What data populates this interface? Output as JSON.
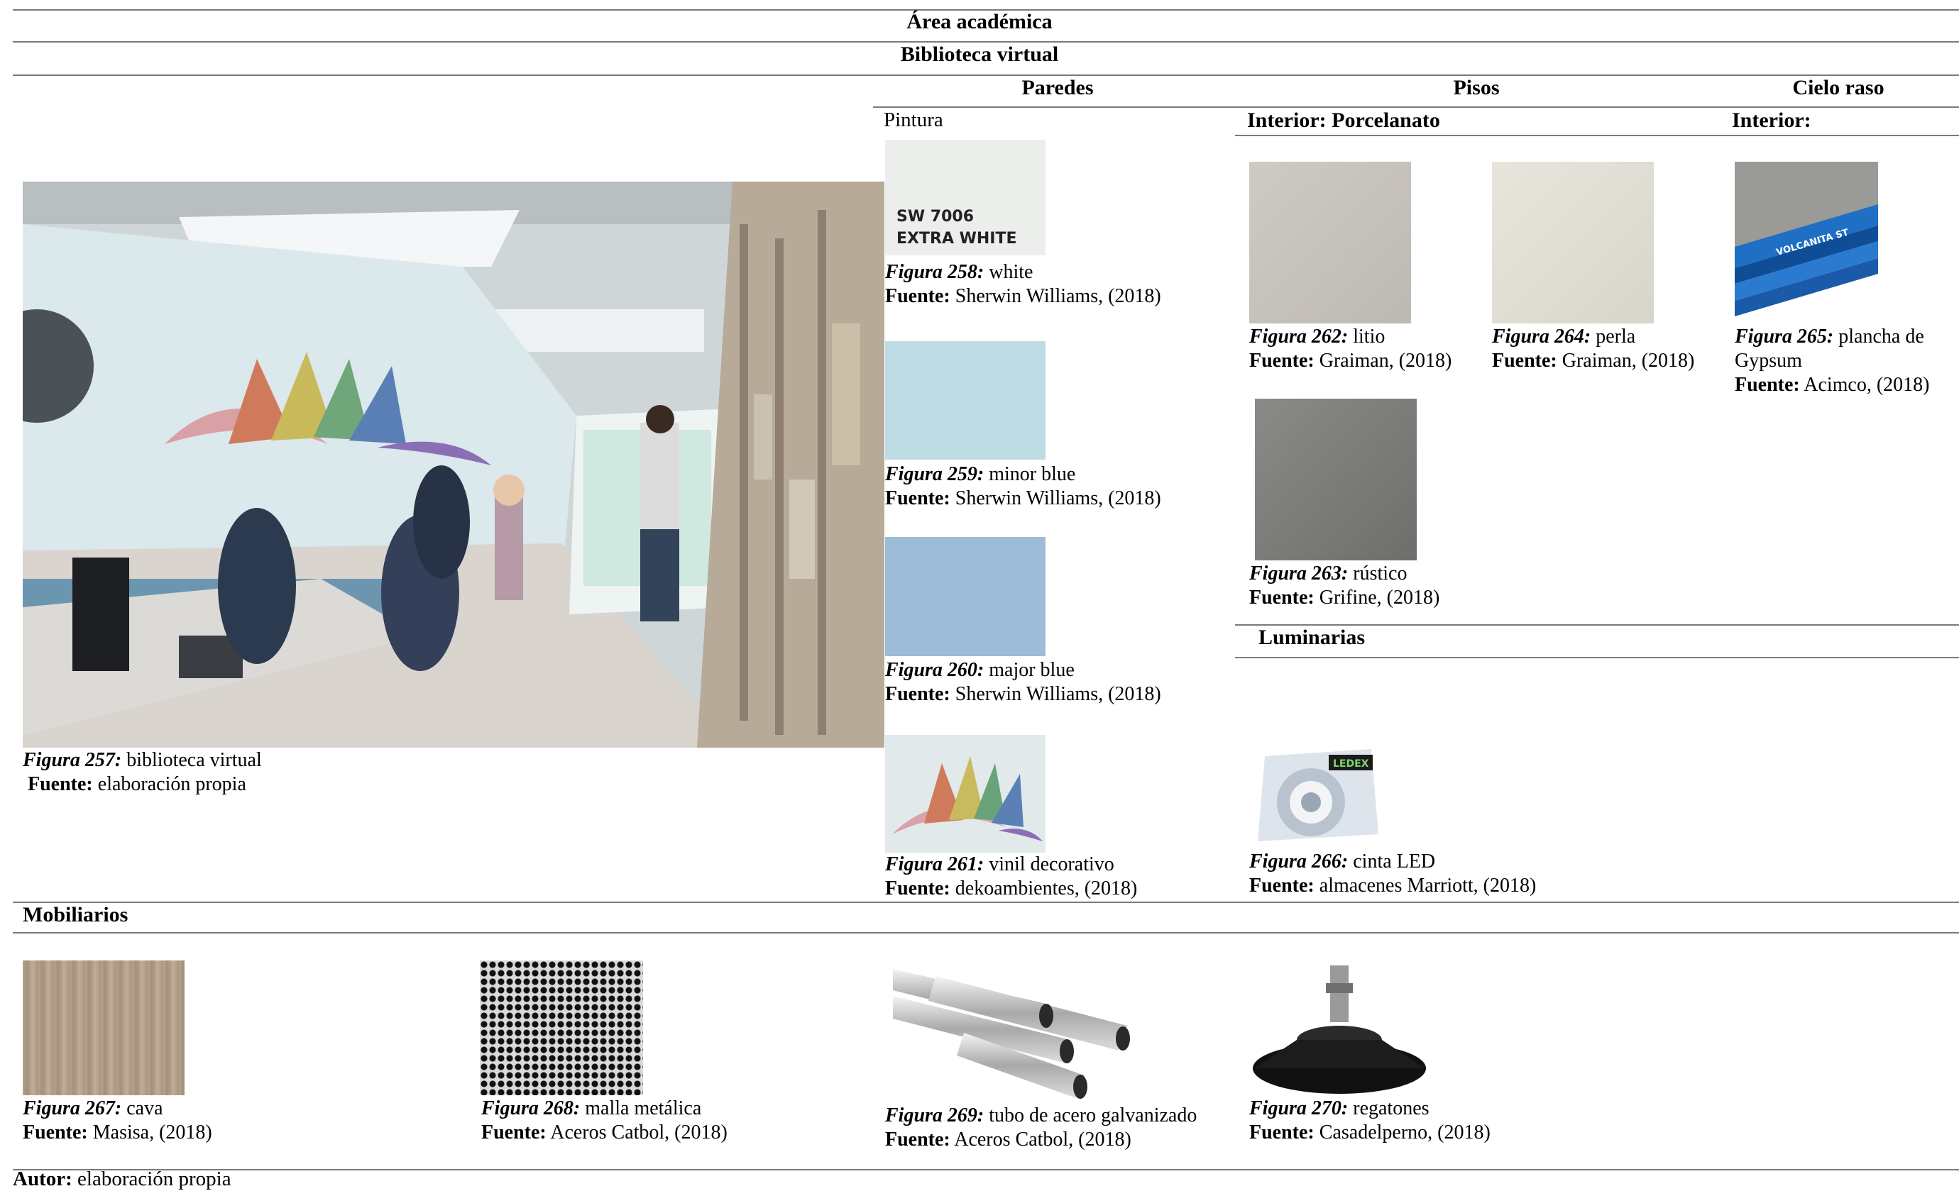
{
  "header": {
    "area": "Área académica",
    "space": "Biblioteca virtual"
  },
  "columns": {
    "paredes": "Paredes",
    "pisos": "Pisos",
    "cielo_raso": "Cielo raso"
  },
  "subheaders": {
    "pintura": "Pintura",
    "pisos_interior": "Interior: Porcelanato",
    "cielo_interior": "Interior:",
    "luminarias": "Luminarias",
    "mobiliarios": "Mobiliarios"
  },
  "swatch_text": {
    "line1": "SW 7006",
    "line2": "EXTRA WHITE"
  },
  "led_brand": "LEDEX",
  "gypsum_print": "VOLCANITA ST",
  "figures": {
    "f257": {
      "label": "Figura 257:",
      "name": " biblioteca virtual",
      "src_label": "Fuente:",
      "src": " elaboración propia"
    },
    "f258": {
      "label": "Figura 258:",
      "name": " white",
      "src_label": "Fuente:",
      "src": " Sherwin Williams, (2018)"
    },
    "f259": {
      "label": "Figura 259:",
      "name": " minor blue",
      "src_label": "Fuente:",
      "src": " Sherwin Williams, (2018)"
    },
    "f260": {
      "label": "Figura 260:",
      "name": " major blue",
      "src_label": "Fuente:",
      "src": " Sherwin Williams, (2018)"
    },
    "f261": {
      "label": "Figura 261:",
      "name": " vinil decorativo",
      "src_label": "Fuente:",
      "src": " dekoambientes, (2018)"
    },
    "f262": {
      "label": "Figura 262:",
      "name": " litio",
      "src_label": "Fuente:",
      "src": " Graiman, (2018)"
    },
    "f263": {
      "label": "Figura 263:",
      "name": " rústico",
      "src_label": "Fuente:",
      "src": " Grifine, (2018)"
    },
    "f264": {
      "label": "Figura 264:",
      "name": " perla",
      "src_label": "Fuente:",
      "src": " Graiman, (2018)"
    },
    "f265": {
      "label": "Figura 265:",
      "name": " plancha de Gypsum",
      "src_label": "Fuente:",
      "src": " Acimco, (2018)"
    },
    "f266": {
      "label": "Figura 266:",
      "name": " cinta LED",
      "src_label": "Fuente:",
      "src": " almacenes Marriott, (2018)"
    },
    "f267": {
      "label": "Figura 267:",
      "name": " cava",
      "src_label": "Fuente:",
      "src": " Masisa, (2018)"
    },
    "f268": {
      "label": "Figura 268:",
      "name": " malla metálica",
      "src_label": "Fuente:",
      "src": " Aceros Catbol, (2018)"
    },
    "f269": {
      "label": "Figura 269:",
      "name": " tubo de acero galvanizado",
      "src_label": "Fuente:",
      "src": " Aceros Catbol, (2018)"
    },
    "f270": {
      "label": "Figura 270:",
      "name": " regatones",
      "src_label": "Fuente:",
      "src": " Casadelperno, (2018)"
    }
  },
  "footer": {
    "label": "Autor:",
    "value": " elaboración propia"
  },
  "colors": {
    "white_paint": "#eceeeb",
    "minor_blue": "#bedce4",
    "major_blue": "#9cbcd8",
    "rule": "#7a7a7a"
  }
}
